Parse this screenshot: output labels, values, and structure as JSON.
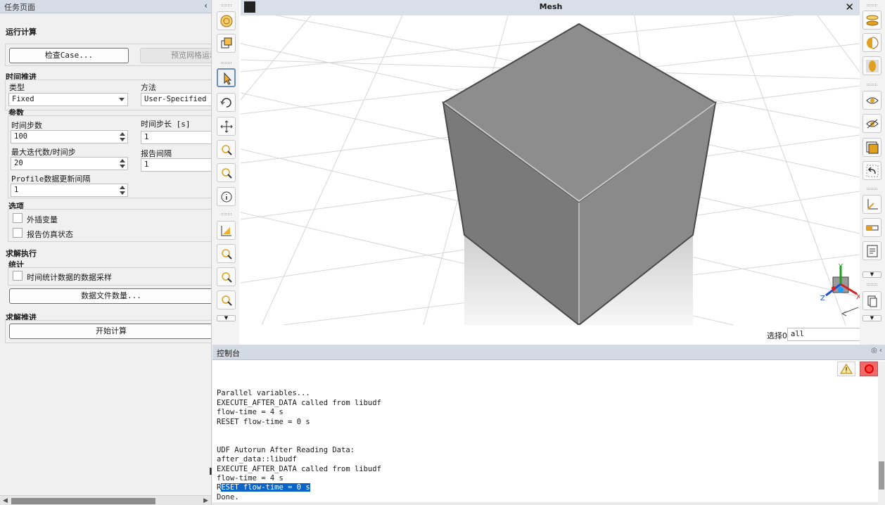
{
  "task_panel": {
    "header_title": "任务页面",
    "collapse_glyph": "‹",
    "run_title": "运行计算",
    "check_case_label": "检查Case...",
    "preview_mesh_label": "预览网格运动...",
    "time_advance_title": "时间推进",
    "type_label": "类型",
    "type_value": "Fixed",
    "method_label": "方法",
    "method_value": "User-Specified",
    "params_title": "参数",
    "num_steps_label": "时间步数",
    "num_steps_value": "100",
    "step_size_label": "时间步长 [s]",
    "step_size_value": "1",
    "max_iter_label": "最大迭代数/时间步",
    "max_iter_value": "20",
    "report_interval_label": "报告间隔",
    "report_interval_value": "1",
    "profile_interval_label": "Profile数据更新间隔",
    "profile_interval_value": "1",
    "options_title": "选项",
    "extrapolate_label": "外插变量",
    "report_sim_status_label": "报告仿真状态",
    "solve_exec_title": "求解执行",
    "stats_title": "统计",
    "time_stats_label": "时间统计数据的数据采样",
    "data_file_qty_label": "数据文件数量...",
    "solve_advance_title": "求解推进",
    "start_calc_label": "开始计算"
  },
  "mesh_window": {
    "title": "Mesh",
    "close_glyph": "✕",
    "selection_label": "选择0",
    "selection_value": "all",
    "axes": {
      "x": "X",
      "y": "Y",
      "z": "Z"
    }
  },
  "console": {
    "title": "控制台",
    "header_icons": "◎ ‹",
    "lines_before": "\nParallel variables...\nEXECUTE_AFTER_DATA called from libudf\nflow-time = 4 s\nRESET flow-time = 0 s\n\n\nUDF Autorun After Reading Data:\nafter_data::libudf\nEXECUTE_AFTER_DATA called from libudf\nflow-time = 4 s\n",
    "selected_line_prefix": "R",
    "selected_text": "ESET flow-time = 0 s",
    "last_line": "Done.",
    "text_cursor": "I"
  },
  "colors": {
    "accent_highlight": "#0a64c8",
    "cube_face": "#8a8a8a",
    "toolbar_icon_orange": "#e0a020"
  }
}
